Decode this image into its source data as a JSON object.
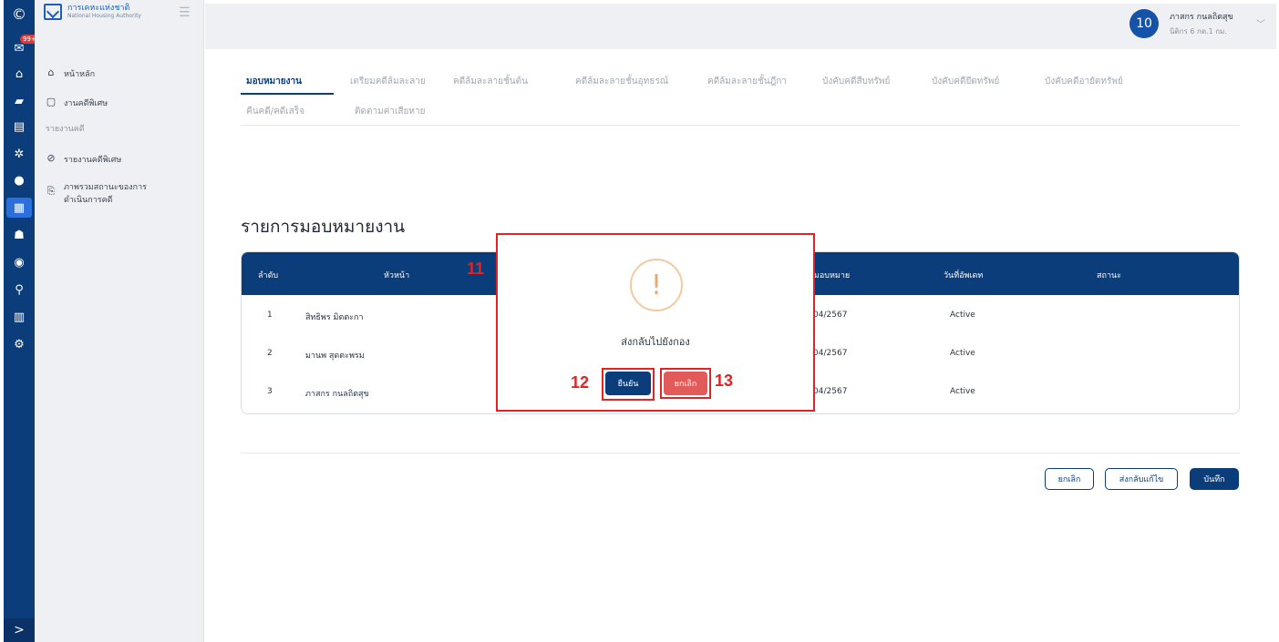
{
  "rail": {
    "badge": "99+",
    "icons": [
      "logo-icon",
      "inbox-icon",
      "home-icon",
      "folder-icon",
      "document-icon",
      "settings-gear-icon",
      "user-icon",
      "dashboard-icon",
      "group-icon",
      "shield-icon",
      "search-icon",
      "chart-icon",
      "cogs-icon"
    ],
    "expand": ">"
  },
  "brand": {
    "name": "การเคหะแห่งชาติ",
    "sub": "National Housing Authority"
  },
  "sidebar": {
    "items": [
      {
        "label": "หน้าหลัก",
        "icon": "home-outline-icon"
      },
      {
        "label": "งานคดีพิเศษ",
        "icon": "bookmark-icon"
      }
    ],
    "section": "รายงานคดี",
    "report_items": [
      {
        "label": "รายงานคดีพิเศษ",
        "icon": "no-entry-icon"
      },
      {
        "label": "ภาพรวมสถานะของการ",
        "label2": "ดำเนินการคดี",
        "icon": "file-icon"
      }
    ]
  },
  "user": {
    "initials": "10",
    "name": "ภาสกร กนลถิตสุข",
    "role": "นิติกร 6 กต.1 กม."
  },
  "tabs": [
    {
      "label": "มอบหมายงาน",
      "active": true
    },
    {
      "label": "เตรียมคดีล้มละลาย",
      "active": false
    },
    {
      "label": "คดีล้มละลายชั้นต้น",
      "active": false
    },
    {
      "label": "คดีล้มละลายชั้นอุทธรณ์",
      "active": false
    },
    {
      "label": "คดีล้มละลายชั้นฎีกา",
      "active": false
    },
    {
      "label": "บังคับคดีสืบทรัพย์",
      "active": false
    },
    {
      "label": "บังคับคดียึดทรัพย์",
      "active": false
    },
    {
      "label": "บังคับคดีอายัดทรัพย์",
      "active": false
    },
    {
      "label": "คืนคดี/คดีเสร็จ",
      "active": false
    },
    {
      "label": "ติดตามค่าเสียหาย",
      "active": false
    }
  ],
  "section_title": "รายการมอบหมายงาน",
  "table": {
    "headers": [
      "ลำดับ",
      "หัวหน้า",
      "ที่มอบหมาย",
      "วันที่อัพเดท",
      "สถานะ"
    ],
    "rows": [
      {
        "no": "1",
        "name": "สิทธิพร มิตตะกา",
        "date": "/04/2567",
        "status": "Active"
      },
      {
        "no": "2",
        "name": "มานพ สุดตะพรม",
        "date": "/04/2567",
        "status": "Active"
      },
      {
        "no": "3",
        "name": "ภาสกร กนลถิตสุข",
        "date": "/04/2567",
        "status": "Active"
      }
    ]
  },
  "footer_buttons": {
    "cancel": "ยกเลิก",
    "send_back": "ส่งกลับแก้ไข",
    "save": "บันทึก"
  },
  "modal": {
    "icon": "warning-exclamation-icon",
    "message": "ส่งกลับไปยังกอง",
    "confirm": "ยืนยัน",
    "cancel": "ยกเลิก"
  },
  "annotations": {
    "modal_label": "11",
    "confirm_label": "12",
    "cancel_label": "13"
  },
  "colors": {
    "primary": "#0c3d7b",
    "annotation_red": "#e02424",
    "cancel_red": "#e35a5a"
  }
}
